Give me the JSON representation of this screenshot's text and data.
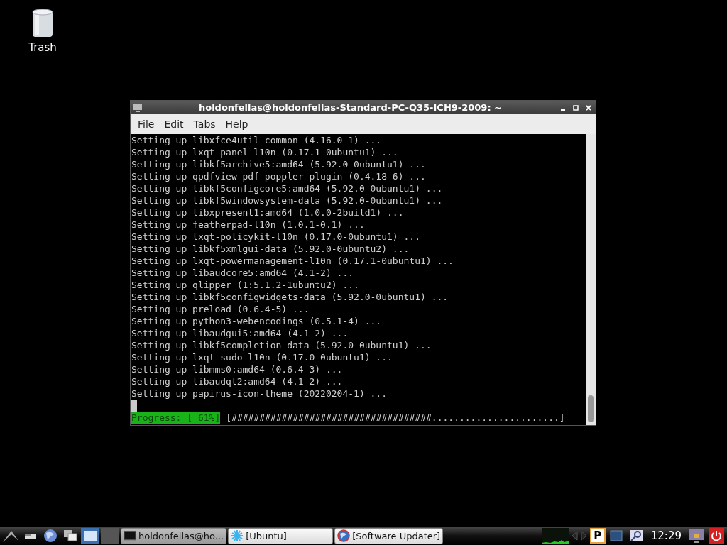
{
  "desktop_icons": [
    {
      "label": "Trash"
    }
  ],
  "window": {
    "title": "holdonfellas@holdonfellas-Standard-PC-Q35-ICH9-2009: ~",
    "menu": [
      "File",
      "Edit",
      "Tabs",
      "Help"
    ],
    "lines": [
      "Setting up libxfce4util-common (4.16.0-1) ...",
      "Setting up lxqt-panel-l10n (0.17.1-0ubuntu1) ...",
      "Setting up libkf5archive5:amd64 (5.92.0-0ubuntu1) ...",
      "Setting up qpdfview-pdf-poppler-plugin (0.4.18-6) ...",
      "Setting up libkf5configcore5:amd64 (5.92.0-0ubuntu1) ...",
      "Setting up libkf5windowsystem-data (5.92.0-0ubuntu1) ...",
      "Setting up libxpresent1:amd64 (1.0.0-2build1) ...",
      "Setting up featherpad-l10n (1.0.1-0.1) ...",
      "Setting up lxqt-policykit-l10n (0.17.0-0ubuntu1) ...",
      "Setting up libkf5xmlgui-data (5.92.0-0ubuntu2) ...",
      "Setting up lxqt-powermanagement-l10n (0.17.1-0ubuntu1) ...",
      "Setting up libaudcore5:amd64 (4.1-2) ...",
      "Setting up qlipper (1:5.1.2-1ubuntu2) ...",
      "Setting up libkf5configwidgets-data (5.92.0-0ubuntu1) ...",
      "Setting up preload (0.6.4-5) ...",
      "Setting up python3-webencodings (0.5.1-4) ...",
      "Setting up libaudgui5:amd64 (4.1-2) ...",
      "Setting up libkf5completion-data (5.92.0-0ubuntu1) ...",
      "Setting up lxqt-sudo-l10n (0.17.0-0ubuntu1) ...",
      "Setting up libmms0:amd64 (0.6.4-3) ...",
      "Setting up libaudqt2:amd64 (4.1-2) ...",
      "Setting up papirus-icon-theme (20220204-1) ..."
    ],
    "progress_label": "Progress: [ 61%]",
    "progress_bar": "[####################################.......................]"
  },
  "taskbar": {
    "tasks": [
      {
        "label": "holdonfellas@ho...",
        "kind": "terminal",
        "selected": true
      },
      {
        "label": "[Ubuntu]",
        "kind": "star",
        "selected": false
      },
      {
        "label": "[Software Updater]",
        "kind": "globe",
        "selected": false
      }
    ],
    "tray_badge": "P",
    "clock": "12:29"
  }
}
